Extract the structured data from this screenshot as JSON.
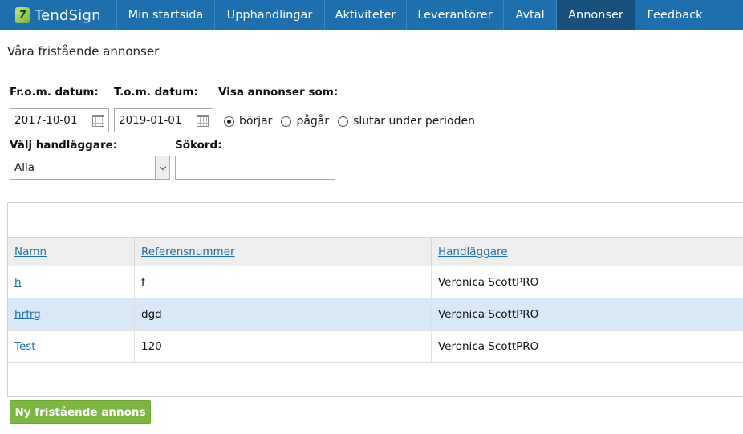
{
  "brand": {
    "name": "TendSign",
    "mark": "7"
  },
  "nav": {
    "items": [
      {
        "label": "Min startsida"
      },
      {
        "label": "Upphandlingar"
      },
      {
        "label": "Aktiviteter"
      },
      {
        "label": "Leverantörer"
      },
      {
        "label": "Avtal"
      },
      {
        "label": "Annonser"
      },
      {
        "label": "Feedback"
      }
    ],
    "active": "Annonser"
  },
  "page": {
    "title": "Våra fristående annonser"
  },
  "filters": {
    "from_label": "Fr.o.m. datum:",
    "from_value": "2017-10-01",
    "to_label": "T.o.m. datum:",
    "to_value": "2019-01-01",
    "show_as_label": "Visa annonser som:",
    "show_as_options": [
      "börjar",
      "pågår",
      "slutar under perioden"
    ],
    "show_as_selected": "börjar",
    "handler_label": "Välj handläggare:",
    "handler_value": "Alla",
    "search_label": "Sökord:",
    "search_value": ""
  },
  "table": {
    "columns": [
      "Namn",
      "Referensnummer",
      "Handläggare"
    ],
    "rows": [
      {
        "name": "h",
        "ref": "f",
        "handler": "Veronica ScottPRO"
      },
      {
        "name": "hrfrg",
        "ref": "dgd",
        "handler": "Veronica ScottPRO"
      },
      {
        "name": "Test",
        "ref": "120",
        "handler": "Veronica ScottPRO"
      }
    ]
  },
  "actions": {
    "new_ad": "Ny fristående annons"
  },
  "colors": {
    "nav_bg": "#1e6fae",
    "nav_active": "#174f7d",
    "link": "#1f6fb0",
    "button_green": "#7cb83d",
    "row_highlight": "#d8e8f6"
  },
  "icons": {
    "date": "calendar-icon",
    "select": "chevron-down-icon"
  }
}
